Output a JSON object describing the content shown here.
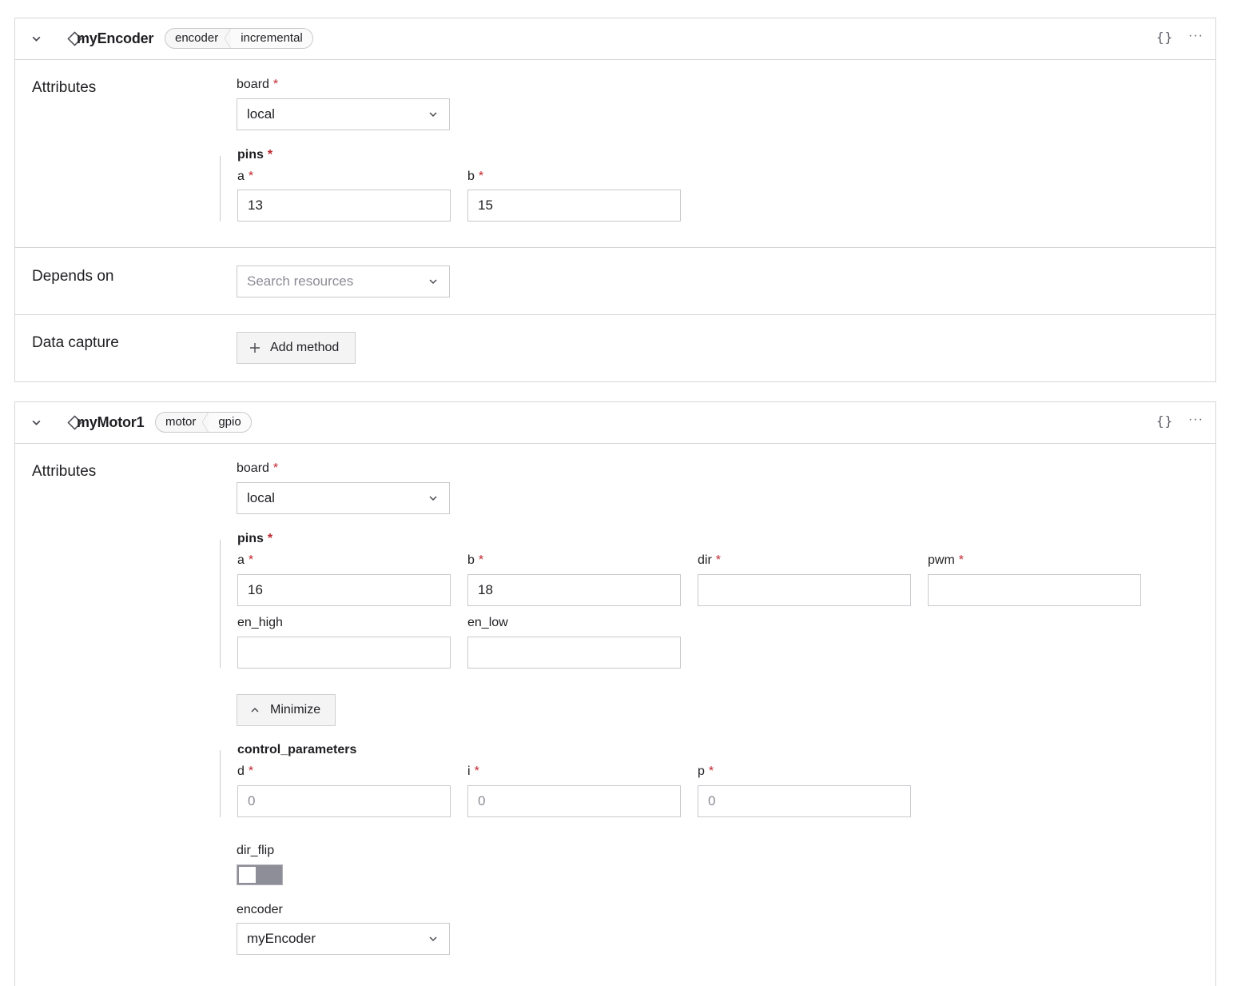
{
  "resources": [
    {
      "name": "myEncoder",
      "type": "encoder",
      "model": "incremental",
      "json_icon": "{}",
      "more_icon": "···",
      "attributes_title": "Attributes",
      "board_label": "board",
      "board_value": "local",
      "pins_label": "pins",
      "pins": [
        {
          "label": "a",
          "value": "13"
        },
        {
          "label": "b",
          "value": "15"
        }
      ],
      "depends_on_title": "Depends on",
      "depends_on_placeholder": "Search resources",
      "data_capture_title": "Data capture",
      "add_method_label": "Add method"
    },
    {
      "name": "myMotor1",
      "type": "motor",
      "model": "gpio",
      "json_icon": "{}",
      "more_icon": "···",
      "attributes_title": "Attributes",
      "board_label": "board",
      "board_value": "local",
      "pins_label": "pins",
      "pins": [
        {
          "label": "a",
          "value": "16"
        },
        {
          "label": "b",
          "value": "18"
        },
        {
          "label": "dir",
          "value": ""
        },
        {
          "label": "pwm",
          "value": ""
        },
        {
          "label": "en_high",
          "value": ""
        },
        {
          "label": "en_low",
          "value": ""
        }
      ],
      "minimize_label": "Minimize",
      "control_parameters_label": "control_parameters",
      "control_parameters": [
        {
          "label": "d",
          "placeholder": "0"
        },
        {
          "label": "i",
          "placeholder": "0"
        },
        {
          "label": "p",
          "placeholder": "0"
        }
      ],
      "dir_flip_label": "dir_flip",
      "dir_flip_on": false,
      "encoder_label": "encoder",
      "encoder_value": "myEncoder"
    }
  ],
  "required_marker": "*",
  "colors": {
    "required": "#c0262d",
    "border": "#d6d6da",
    "toggle_off": "#8e8e98"
  }
}
